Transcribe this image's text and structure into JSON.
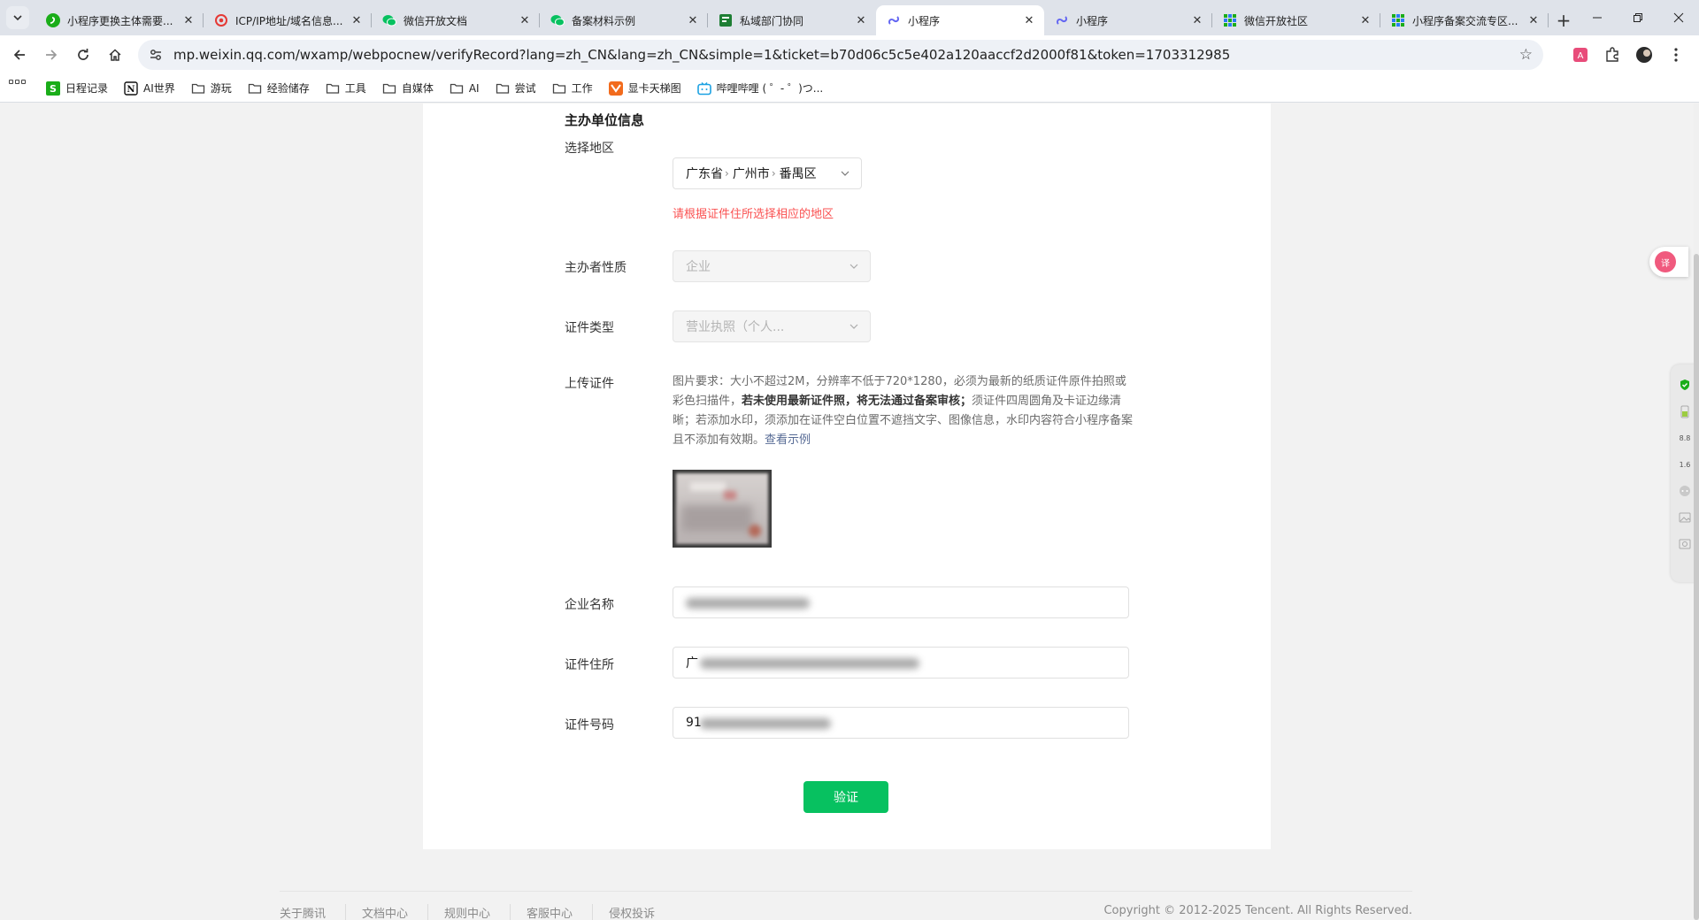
{
  "browser": {
    "tabs": [
      {
        "title": "小程序更换主体需要...",
        "icon": "mini-program-green-icon",
        "active": false
      },
      {
        "title": "ICP/IP地址/域名信息...",
        "icon": "icp-red-icon",
        "active": false
      },
      {
        "title": "微信开放文档",
        "icon": "wechat-icon",
        "active": false
      },
      {
        "title": "备案材料示例",
        "icon": "wechat-icon",
        "active": false
      },
      {
        "title": "私域部门协同",
        "icon": "doc-green-icon",
        "active": false
      },
      {
        "title": "小程序",
        "icon": "mini-program-link-icon",
        "active": true
      },
      {
        "title": "小程序",
        "icon": "mini-program-link-icon",
        "active": false
      },
      {
        "title": "微信开放社区",
        "icon": "community-icon",
        "active": false
      },
      {
        "title": "小程序备案交流专区...",
        "icon": "community-icon",
        "active": false
      }
    ],
    "url": "mp.weixin.qq.com/wxamp/webpocnew/verifyRecord?lang=zh_CN&lang=zh_CN&simple=1&ticket=b70d06c5c5e402a120aaccf2d2000f81&token=1703312985",
    "bookmarks": [
      {
        "label": "日程记录",
        "icon": "s-green-icon"
      },
      {
        "label": "AI世界",
        "icon": "notion-icon"
      },
      {
        "label": "游玩",
        "icon": "folder-icon"
      },
      {
        "label": "经验储存",
        "icon": "folder-icon"
      },
      {
        "label": "工具",
        "icon": "folder-icon"
      },
      {
        "label": "自媒体",
        "icon": "folder-icon"
      },
      {
        "label": "AI",
        "icon": "folder-icon"
      },
      {
        "label": "尝试",
        "icon": "folder-icon"
      },
      {
        "label": "工作",
        "icon": "folder-icon"
      },
      {
        "label": "显卡天梯图",
        "icon": "orange-fox-icon"
      },
      {
        "label": "哔哩哔哩 ( ゜- ゜)つ...",
        "icon": "bilibili-icon"
      }
    ]
  },
  "form": {
    "section_title": "主办单位信息",
    "region": {
      "label": "选择地区",
      "province": "广东省",
      "city": "广州市",
      "district": "番禺区",
      "hint": "请根据证件住所选择相应的地区"
    },
    "nature": {
      "label": "主办者性质",
      "value": "企业"
    },
    "cert_type": {
      "label": "证件类型",
      "value": "营业执照（个人..."
    },
    "upload": {
      "label": "上传证件",
      "req_part1": "图片要求：大小不超过2M，分辨率不低于720*1280，必须为最新的纸质证件原件拍照或彩色扫描件，",
      "req_bold": "若未使用最新证件照，将无法通过备案审核；",
      "req_part2": "须证件四周圆角及卡证边缘清晰；若添加水印，须添加在证件空白位置不遮挡文字、图像信息，水印内容符合小程序备案且不添加有效期。",
      "example_link": "查看示例"
    },
    "company_name": {
      "label": "企业名称",
      "value_visible": ""
    },
    "cert_address": {
      "label": "证件住所",
      "value_visible": "广"
    },
    "cert_number": {
      "label": "证件号码",
      "value_visible": "91"
    },
    "verify_button": "验证"
  },
  "footer": {
    "links": [
      "关于腾讯",
      "文档中心",
      "规则中心",
      "客服中心",
      "侵权投诉"
    ],
    "copyright": "Copyright © 2012-2025 Tencent. All Rights Reserved."
  },
  "widgets": {
    "translate_glyph": "译",
    "speed_up": "8.8",
    "speed_down": "1.6"
  },
  "colors": {
    "primary": "#07c160",
    "warning": "#fa5151",
    "link": "#576b95"
  }
}
